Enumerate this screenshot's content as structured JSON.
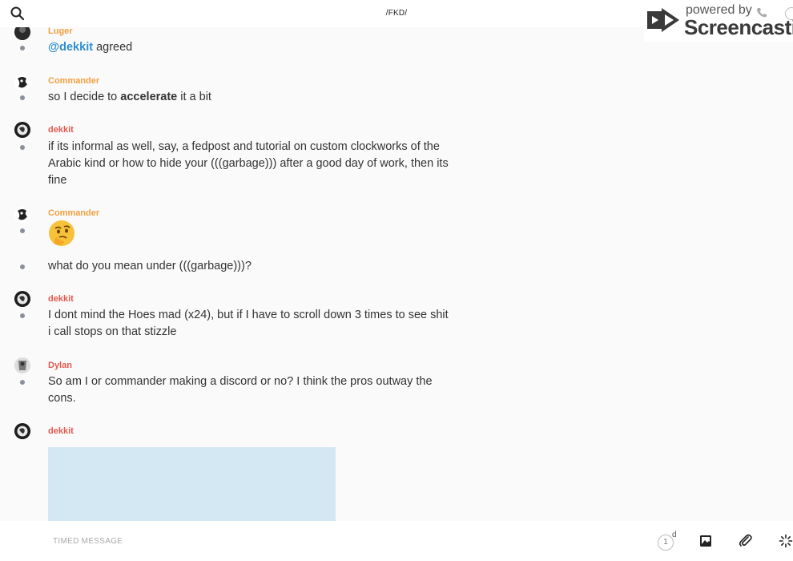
{
  "header": {
    "title": "/FKD/",
    "search_icon": "search-icon"
  },
  "watermark": {
    "powered": "powered by",
    "brand": "Screencastify"
  },
  "colors": {
    "author_orange": "#f0a040",
    "author_red": "#e05a4f",
    "mention": "#2d8fd1",
    "image_placeholder": "#d4e8f4"
  },
  "messages": [
    {
      "author": "Luger",
      "lines": [
        "agreed"
      ],
      "mention": "@dekkit"
    },
    {
      "author": "Commander",
      "line_prefix": "so I decide to ",
      "line_bold": "accelerate",
      "line_suffix": " it a bit"
    },
    {
      "author": "dekkit",
      "lines": [
        "if its informal as well, say, a fedpost and tutorial on custom clockworks of the",
        "Arabic kind or how to hide your (((garbage))) after a good day of work, then its",
        "fine"
      ]
    },
    {
      "author": "Commander",
      "emoji": "thinking-face-emoji",
      "lines": [
        "what do you mean under (((garbage)))?"
      ]
    },
    {
      "author": "dekkit",
      "lines": [
        "I dont mind the Hoes mad (x24), but if I have to scroll down 3 times to see shit",
        "i call stops on that stizzle"
      ]
    },
    {
      "author": "Dylan",
      "lines": [
        "So am I or commander making a discord or no? I think the pros outway the",
        "cons."
      ]
    },
    {
      "author": "dekkit",
      "attachment": "image-attachment"
    }
  ],
  "composer": {
    "placeholder": "TIMED MESSAGE",
    "timer_value": "1",
    "timer_unit": "d"
  }
}
